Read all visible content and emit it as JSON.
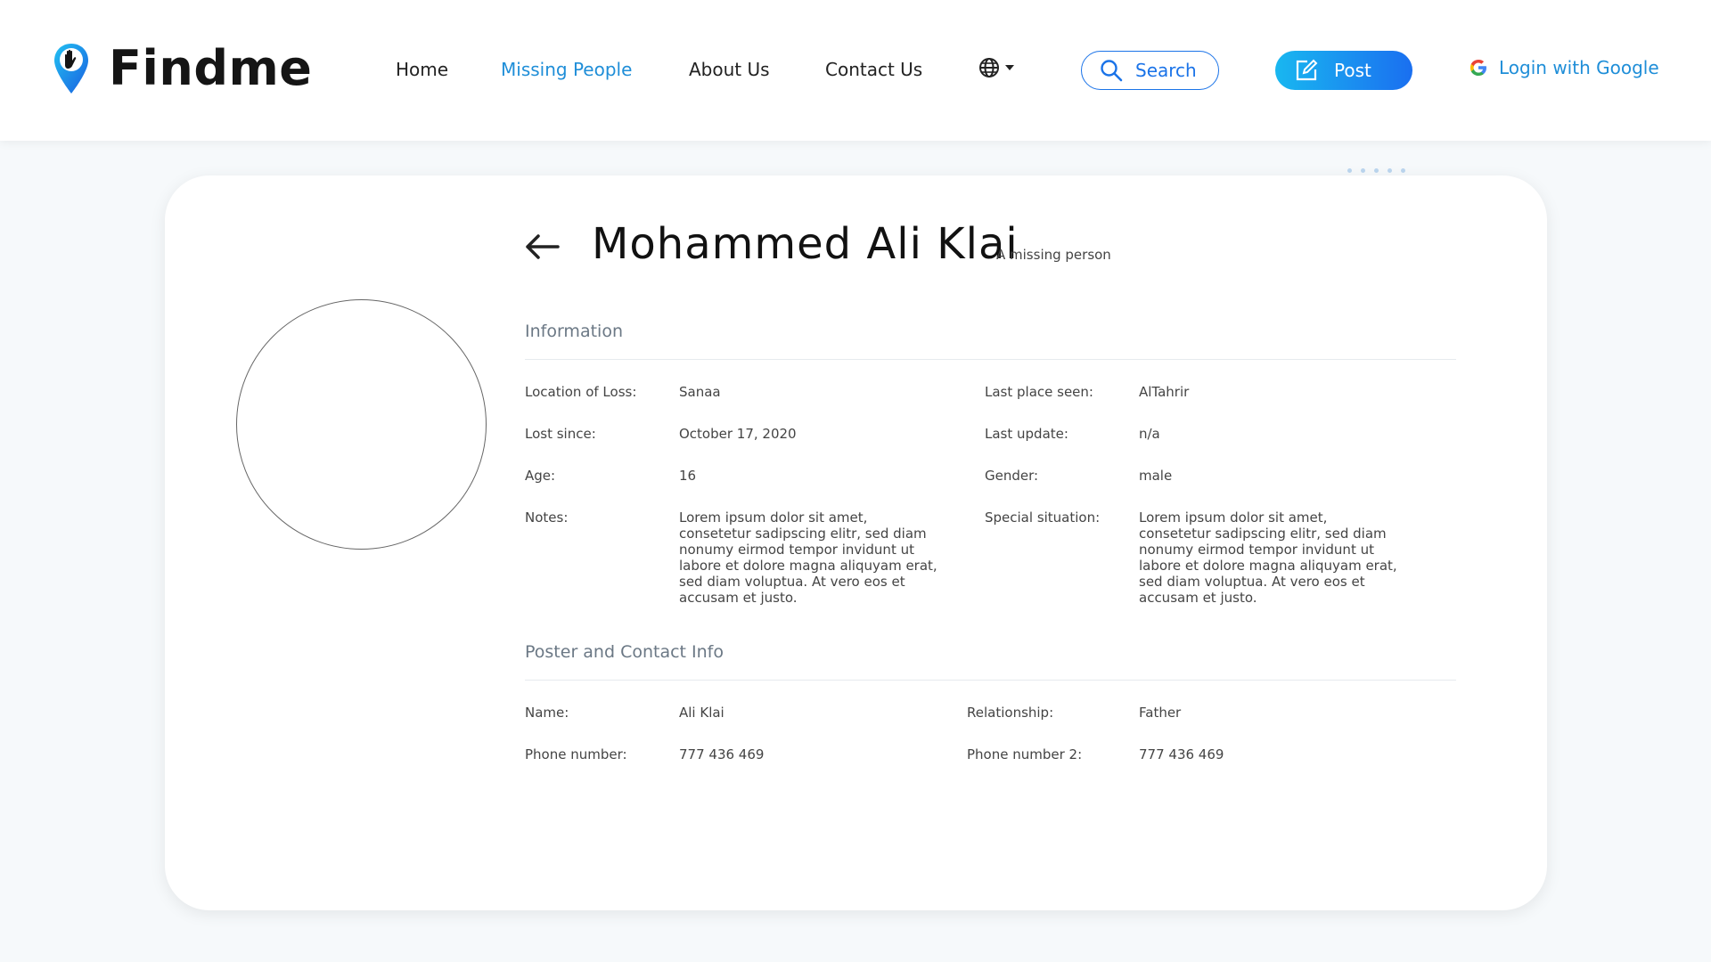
{
  "brand": {
    "name": "Findme"
  },
  "nav": {
    "home": "Home",
    "missing_people": "Missing People",
    "about": "About Us",
    "contact": "Contact Us"
  },
  "header": {
    "search_label": "Search",
    "post_label": "Post",
    "login_label": "Login with Google",
    "language_icon": "globe-icon"
  },
  "colors": {
    "accent": "#1f8ed8",
    "search_border": "#1a73e8",
    "post_gradient_start": "#19b7f0",
    "post_gradient_end": "#1a6ff0",
    "page_bg": "#f6f9fb"
  },
  "person": {
    "name": "Mohammed Ali Klai",
    "subtitle": "A missing person"
  },
  "information": {
    "title": "Information",
    "location_of_loss": {
      "label": "Location of Loss:",
      "value": "Sanaa"
    },
    "last_place_seen": {
      "label": "Last place seen:",
      "value": "AlTahrir"
    },
    "lost_since": {
      "label": "Lost since:",
      "value": "October 17, 2020"
    },
    "last_update": {
      "label": "Last update:",
      "value": "n/a"
    },
    "age": {
      "label": "Age:",
      "value": "16"
    },
    "gender": {
      "label": "Gender:",
      "value": "male"
    },
    "notes": {
      "label": "Notes:",
      "value": "Lorem ipsum dolor sit amet, consetetur sadipscing elitr, sed diam nonumy eirmod tempor invidunt ut labore et dolore magna aliquyam erat, sed diam voluptua. At vero eos et accusam et justo."
    },
    "special_situation": {
      "label": "Special situation:",
      "value": "Lorem ipsum dolor sit amet, consetetur sadipscing elitr, sed diam nonumy eirmod tempor invidunt ut labore et dolore magna aliquyam erat, sed diam voluptua. At vero eos et accusam et justo."
    }
  },
  "poster": {
    "title": "Poster and Contact Info",
    "name": {
      "label": "Name:",
      "value": "Ali Klai"
    },
    "relationship": {
      "label": "Relationship:",
      "value": "Father"
    },
    "phone": {
      "label": "Phone number:",
      "value": "777 436 469"
    },
    "phone2": {
      "label": "Phone number 2:",
      "value": "777 436 469"
    }
  }
}
